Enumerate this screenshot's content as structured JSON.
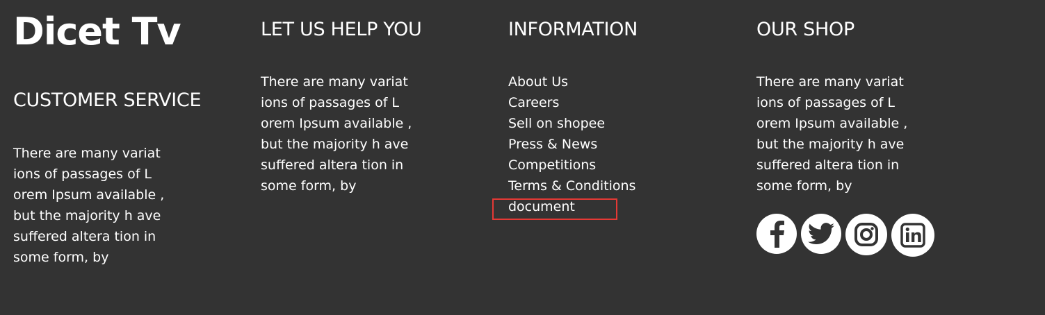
{
  "brand": {
    "logo_text": "Dicet Tv"
  },
  "columns": {
    "customer_service": {
      "heading": "CUSTOMER SERVICE",
      "lines": [
        "There are many variat",
        "ions of passages of L",
        "orem Ipsum available ,",
        "but the majority h ave",
        "suffered altera tion in",
        "some form, by"
      ]
    },
    "help": {
      "heading": "LET US HELP YOU",
      "lines": [
        "There are many variat",
        "ions of passages of L",
        "orem Ipsum available ,",
        "but the majority h ave",
        "suffered altera tion in",
        "some form, by"
      ]
    },
    "information": {
      "heading": "INFORMATION",
      "links": [
        "About Us",
        "Careers",
        "Sell on shopee",
        "Press & News",
        "Competitions",
        "Terms & Conditions",
        "document"
      ]
    },
    "shop": {
      "heading": "OUR SHOP",
      "lines": [
        "There are many variat",
        "ions of passages of L",
        "orem Ipsum available ,",
        "but the majority h ave",
        "suffered altera tion in",
        "some form, by"
      ],
      "socials": [
        {
          "icon": "facebook-icon"
        },
        {
          "icon": "twitter-icon"
        },
        {
          "icon": "instagram-icon"
        },
        {
          "icon": "linkedin-icon"
        }
      ]
    }
  },
  "colors": {
    "background": "#333333",
    "text": "#ffffff",
    "highlight_border": "#e53935"
  }
}
